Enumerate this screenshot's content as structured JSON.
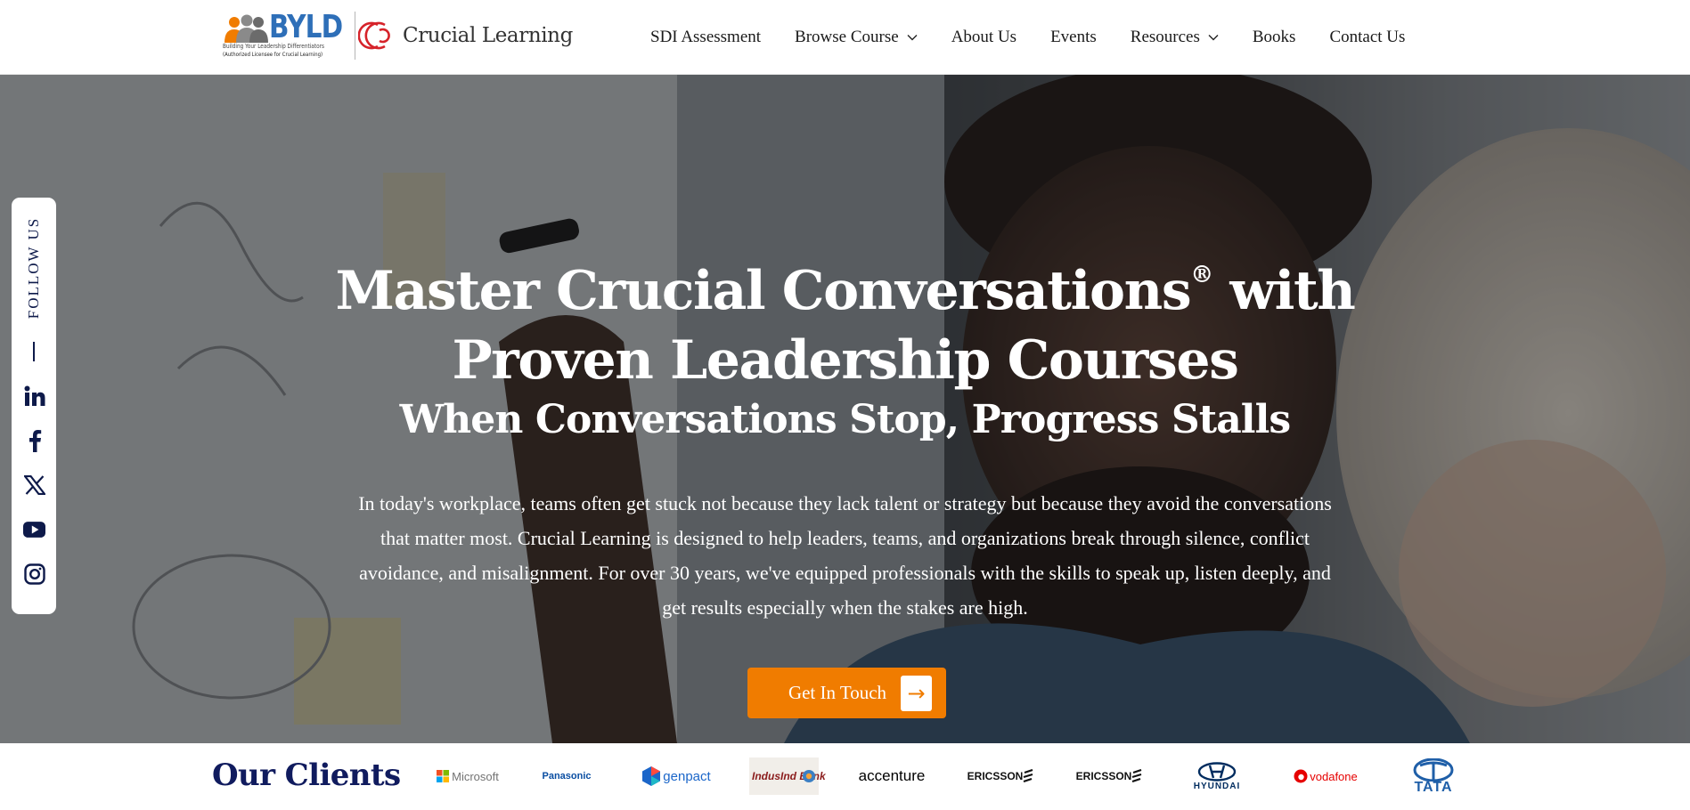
{
  "header": {
    "logo_primary": "BYLD",
    "logo_tagline": "Building Your Leadership Differentiators",
    "logo_license": "(Authorized Licensee for Crucial Learning)",
    "logo_secondary": "Crucial Learning",
    "nav": [
      {
        "label": "SDI Assessment",
        "has_dropdown": false
      },
      {
        "label": "Browse Course",
        "has_dropdown": true
      },
      {
        "label": "About Us",
        "has_dropdown": false
      },
      {
        "label": "Events",
        "has_dropdown": false
      },
      {
        "label": "Resources",
        "has_dropdown": true
      },
      {
        "label": "Books",
        "has_dropdown": false
      },
      {
        "label": "Contact Us",
        "has_dropdown": false
      }
    ]
  },
  "follow": {
    "label": "FOLLOW US",
    "icons": [
      "linkedin-icon",
      "facebook-icon",
      "x-twitter-icon",
      "youtube-icon",
      "instagram-icon"
    ]
  },
  "hero": {
    "title_line1": "Master Crucial Conversations",
    "title_reg": "®",
    "title_line1_end": " with",
    "title_line2": "Proven Leadership Courses",
    "subtitle": "When Conversations Stop, Progress Stalls",
    "paragraph": "In today's workplace, teams often get stuck not because they lack talent or strategy but because they avoid the conversations that matter most. Crucial Learning is designed to help leaders, teams, and organizations break through silence, conflict avoidance, and misalignment. For over 30 years, we've equipped professionals with the skills to speak up, listen deeply, and get results especially when the stakes are high.",
    "cta_label": "Get In Touch",
    "cta_arrow": "→"
  },
  "clients": {
    "title": "Our Clients",
    "logos": [
      {
        "name": "Microsoft",
        "color": "#737373"
      },
      {
        "name": "Panasonic",
        "color": "#0a4ea2"
      },
      {
        "name": "genpact",
        "color": "#1b66c9"
      },
      {
        "name": "IndusInd Bank",
        "color": "#8b1c1c"
      },
      {
        "name": "accenture",
        "color": "#000000"
      },
      {
        "name": "ERICSSON",
        "color": "#111111"
      },
      {
        "name": "ERICSSON",
        "color": "#111111"
      },
      {
        "name": "HYUNDAI",
        "color": "#002c5f"
      },
      {
        "name": "vodafone",
        "color": "#e60000"
      },
      {
        "name": "TATA",
        "color": "#1f5fa8"
      }
    ]
  },
  "colors": {
    "accent": "#f07c00",
    "navy": "#101b5e",
    "logo_blue": "#2e6fb8",
    "logo_red": "#d6232a"
  }
}
